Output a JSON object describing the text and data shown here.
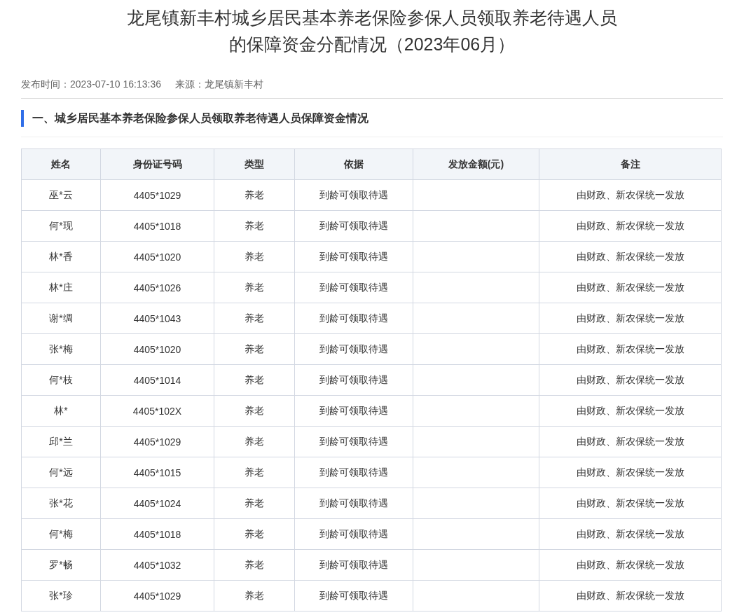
{
  "article": {
    "title": "龙尾镇新丰村城乡居民基本养老保险参保人员领取养老待遇人员的保障资金分配情况（2023年06月）",
    "publish_time": "发布时间：2023-07-10 16:13:36",
    "source": "来源：龙尾镇新丰村"
  },
  "section": {
    "heading": "一、城乡居民基本养老保险参保人员领取养老待遇人员保障资金情况"
  },
  "table": {
    "columns": [
      "姓名",
      "身份证号码",
      "类型",
      "依据",
      "发放金额(元)",
      "备注"
    ],
    "rows": [
      [
        "巫*云",
        "4405*1029",
        "养老",
        "到龄可领取待遇",
        "",
        "由财政、新农保统一发放"
      ],
      [
        "何*现",
        "4405*1018",
        "养老",
        "到龄可领取待遇",
        "",
        "由财政、新农保统一发放"
      ],
      [
        "林*香",
        "4405*1020",
        "养老",
        "到龄可领取待遇",
        "",
        "由财政、新农保统一发放"
      ],
      [
        "林*庄",
        "4405*1026",
        "养老",
        "到龄可领取待遇",
        "",
        "由财政、新农保统一发放"
      ],
      [
        "谢*绸",
        "4405*1043",
        "养老",
        "到龄可领取待遇",
        "",
        "由财政、新农保统一发放"
      ],
      [
        "张*梅",
        "4405*1020",
        "养老",
        "到龄可领取待遇",
        "",
        "由财政、新农保统一发放"
      ],
      [
        "何*枝",
        "4405*1014",
        "养老",
        "到龄可领取待遇",
        "",
        "由财政、新农保统一发放"
      ],
      [
        "林*",
        "4405*102X",
        "养老",
        "到龄可领取待遇",
        "",
        "由财政、新农保统一发放"
      ],
      [
        "邱*兰",
        "4405*1029",
        "养老",
        "到龄可领取待遇",
        "",
        "由财政、新农保统一发放"
      ],
      [
        "何*远",
        "4405*1015",
        "养老",
        "到龄可领取待遇",
        "",
        "由财政、新农保统一发放"
      ],
      [
        "张*花",
        "4405*1024",
        "养老",
        "到龄可领取待遇",
        "",
        "由财政、新农保统一发放"
      ],
      [
        "何*梅",
        "4405*1018",
        "养老",
        "到龄可领取待遇",
        "",
        "由财政、新农保统一发放"
      ],
      [
        "罗*畅",
        "4405*1032",
        "养老",
        "到龄可领取待遇",
        "",
        "由财政、新农保统一发放"
      ],
      [
        "张*珍",
        "4405*1029",
        "养老",
        "到龄可领取待遇",
        "",
        "由财政、新农保统一发放"
      ]
    ]
  }
}
